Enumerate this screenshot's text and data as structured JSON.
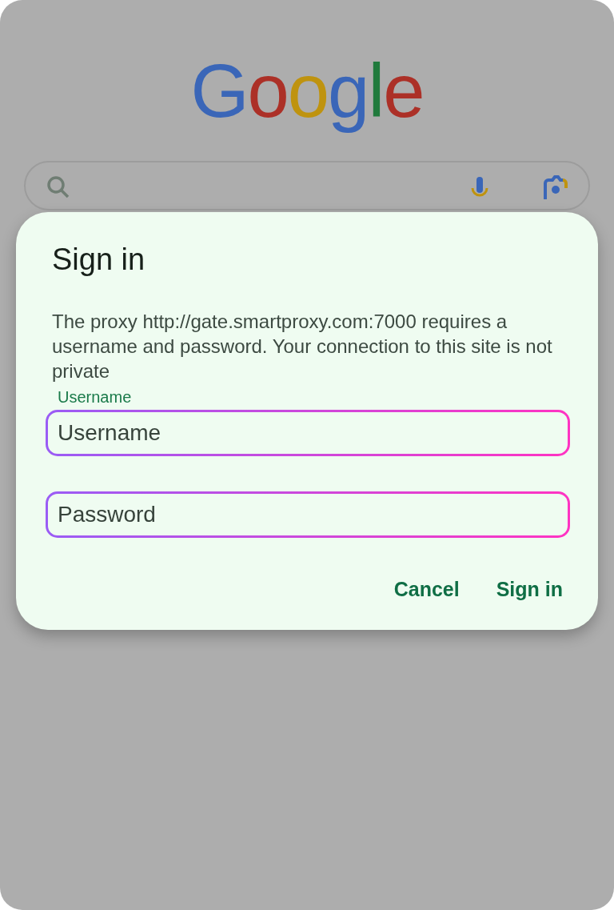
{
  "logo": {
    "text": "Google"
  },
  "dialog": {
    "title": "Sign in",
    "message": "The proxy http://gate.smartproxy.com:7000 requires a username and password. Your connection to this site is not private",
    "fields": [
      {
        "label": "Username",
        "placeholder": "Username"
      },
      {
        "placeholder": "Password"
      }
    ],
    "buttons": [
      "Cancel",
      "Sign in"
    ]
  }
}
